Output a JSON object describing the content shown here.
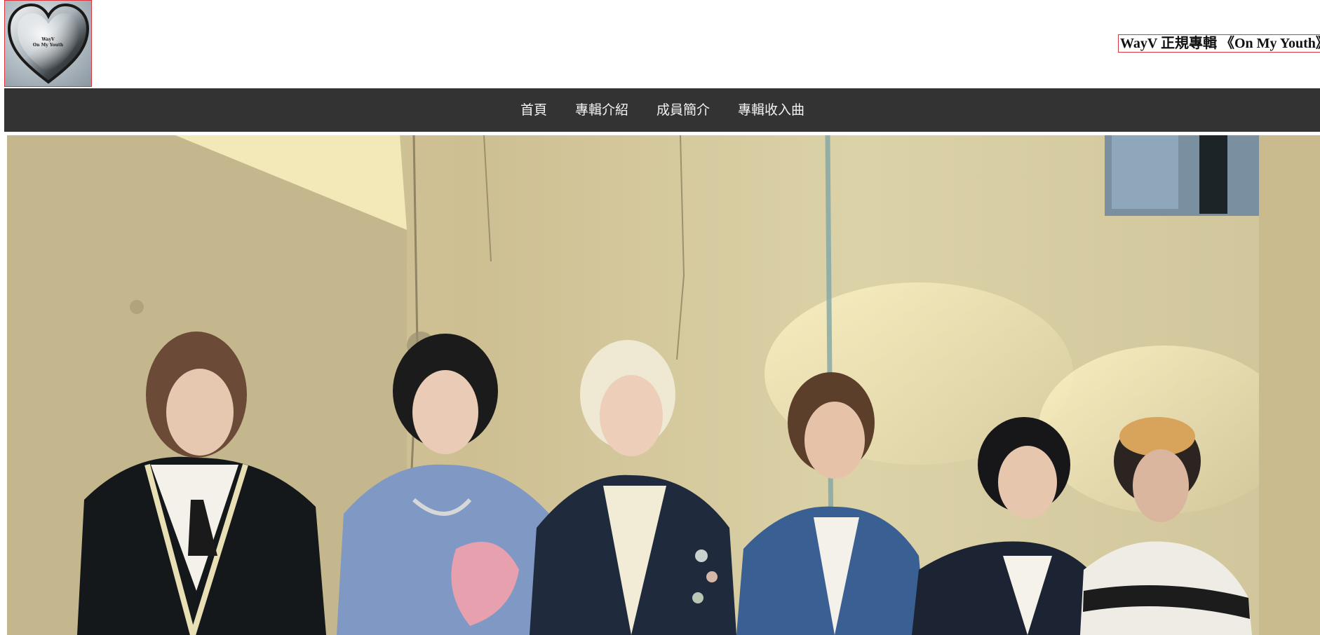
{
  "header": {
    "logo": {
      "alt_lines": [
        "WayV",
        "On My Youth"
      ]
    },
    "site_title": "WayV 正規專輯 《On My Youth》"
  },
  "nav": {
    "items": [
      {
        "label": "首頁"
      },
      {
        "label": "專輯介紹"
      },
      {
        "label": "成員簡介"
      },
      {
        "label": "專輯收入曲"
      }
    ]
  },
  "hero": {
    "description": "group-photo",
    "colors": {
      "wall": "#d9cfa5",
      "shadow": "#b9ad88",
      "sky": "#6f8fa8"
    }
  }
}
